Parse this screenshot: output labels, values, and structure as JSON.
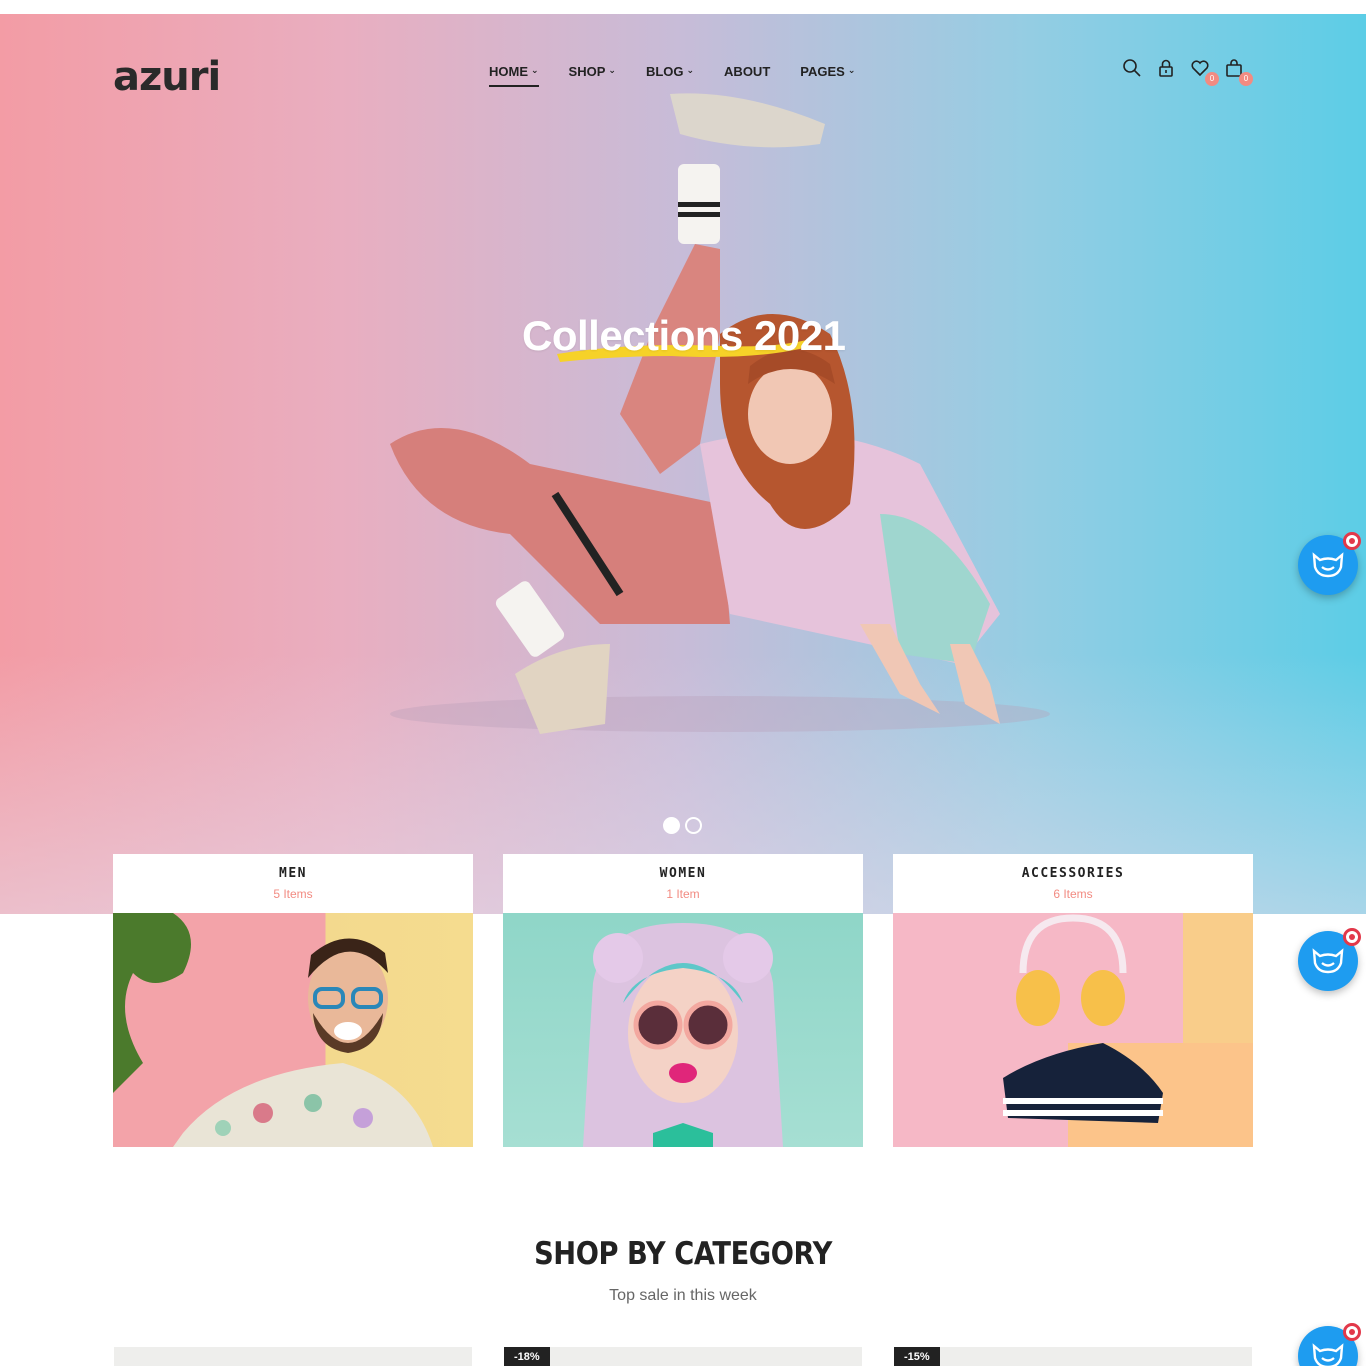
{
  "header": {
    "logo": "azuri",
    "nav": [
      {
        "label": "HOME",
        "has_dropdown": true,
        "active": true
      },
      {
        "label": "SHOP",
        "has_dropdown": true
      },
      {
        "label": "BLOG",
        "has_dropdown": true
      },
      {
        "label": "ABOUT",
        "has_dropdown": false
      },
      {
        "label": "PAGES",
        "has_dropdown": true
      }
    ],
    "icons": [
      "search-icon",
      "lock-icon",
      "heart-icon",
      "bag-icon"
    ],
    "wishlist_count": "0",
    "cart_count": "0"
  },
  "hero": {
    "title": "Collections 2021",
    "slides": 2,
    "active_slide": 1
  },
  "categories": [
    {
      "name": "MEN",
      "count": "5 Items"
    },
    {
      "name": "WOMEN",
      "count": "1 Item"
    },
    {
      "name": "ACCESSORIES",
      "count": "6 Items"
    }
  ],
  "section": {
    "title": "SHOP BY CATEGORY",
    "subtitle": "Top sale in this week"
  },
  "products": [
    {
      "badge": ""
    },
    {
      "badge": "-18%"
    },
    {
      "badge": "-15%"
    }
  ],
  "colors": {
    "accent": "#f28b82",
    "dark": "#222222",
    "chat_button": "#1e9cf0"
  }
}
